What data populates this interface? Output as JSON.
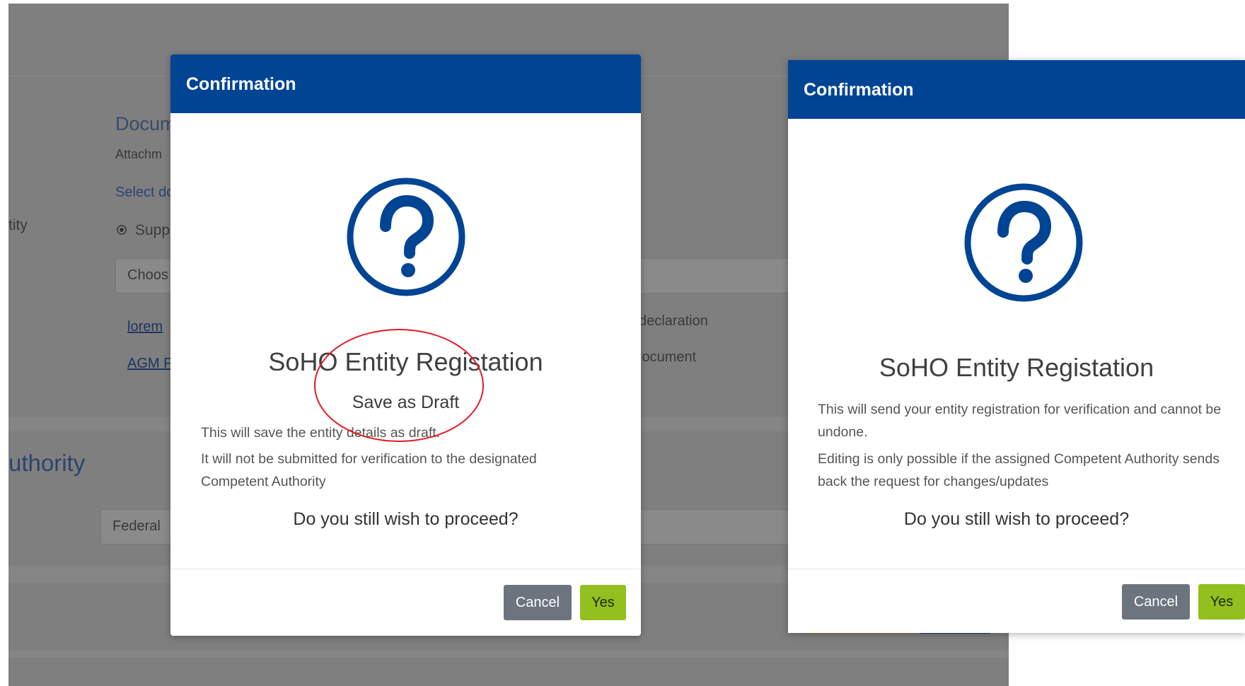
{
  "background": {
    "section_heading_fragment": "Docum",
    "attachment_label_fragment": "Attachm",
    "select_doc_fragment": "Select dc",
    "entity_label_fragment": "tity",
    "radio_label_fragment": "Supp",
    "choose_button_fragment": "Choos",
    "file_links": [
      "lorem",
      "AGM F"
    ],
    "declaration_fragment": "declaration",
    "document_fragment": "locument",
    "authority_heading_fragment": "uthority",
    "authority_select_fragment": "Federal"
  },
  "modal_draft": {
    "title": "Confirmation",
    "icon": "question-circle-icon",
    "heading": "SoHO Entity Registation",
    "subheading": "Save as Draft",
    "line1": "This will save the entity details as draft.",
    "line2": "It will not be submitted for verification to the designated Competent Authority",
    "question": "Do you still wish to proceed?",
    "cancel_label": "Cancel",
    "yes_label": "Yes"
  },
  "modal_submit": {
    "title": "Confirmation",
    "icon": "question-circle-icon",
    "heading": "SoHO Entity Registation",
    "line1": "This will send your entity registration for verification and cannot be undone.",
    "line2": "Editing is only possible if the assigned Competent Authority sends back the request for changes/updates",
    "question": "Do you still wish to proceed?",
    "cancel_label": "Cancel",
    "yes_label": "Yes"
  },
  "colors": {
    "header_blue": "#004494",
    "yes_green": "#93c01f",
    "cancel_gray": "#6c757d",
    "annotation_red": "#e31b23"
  }
}
